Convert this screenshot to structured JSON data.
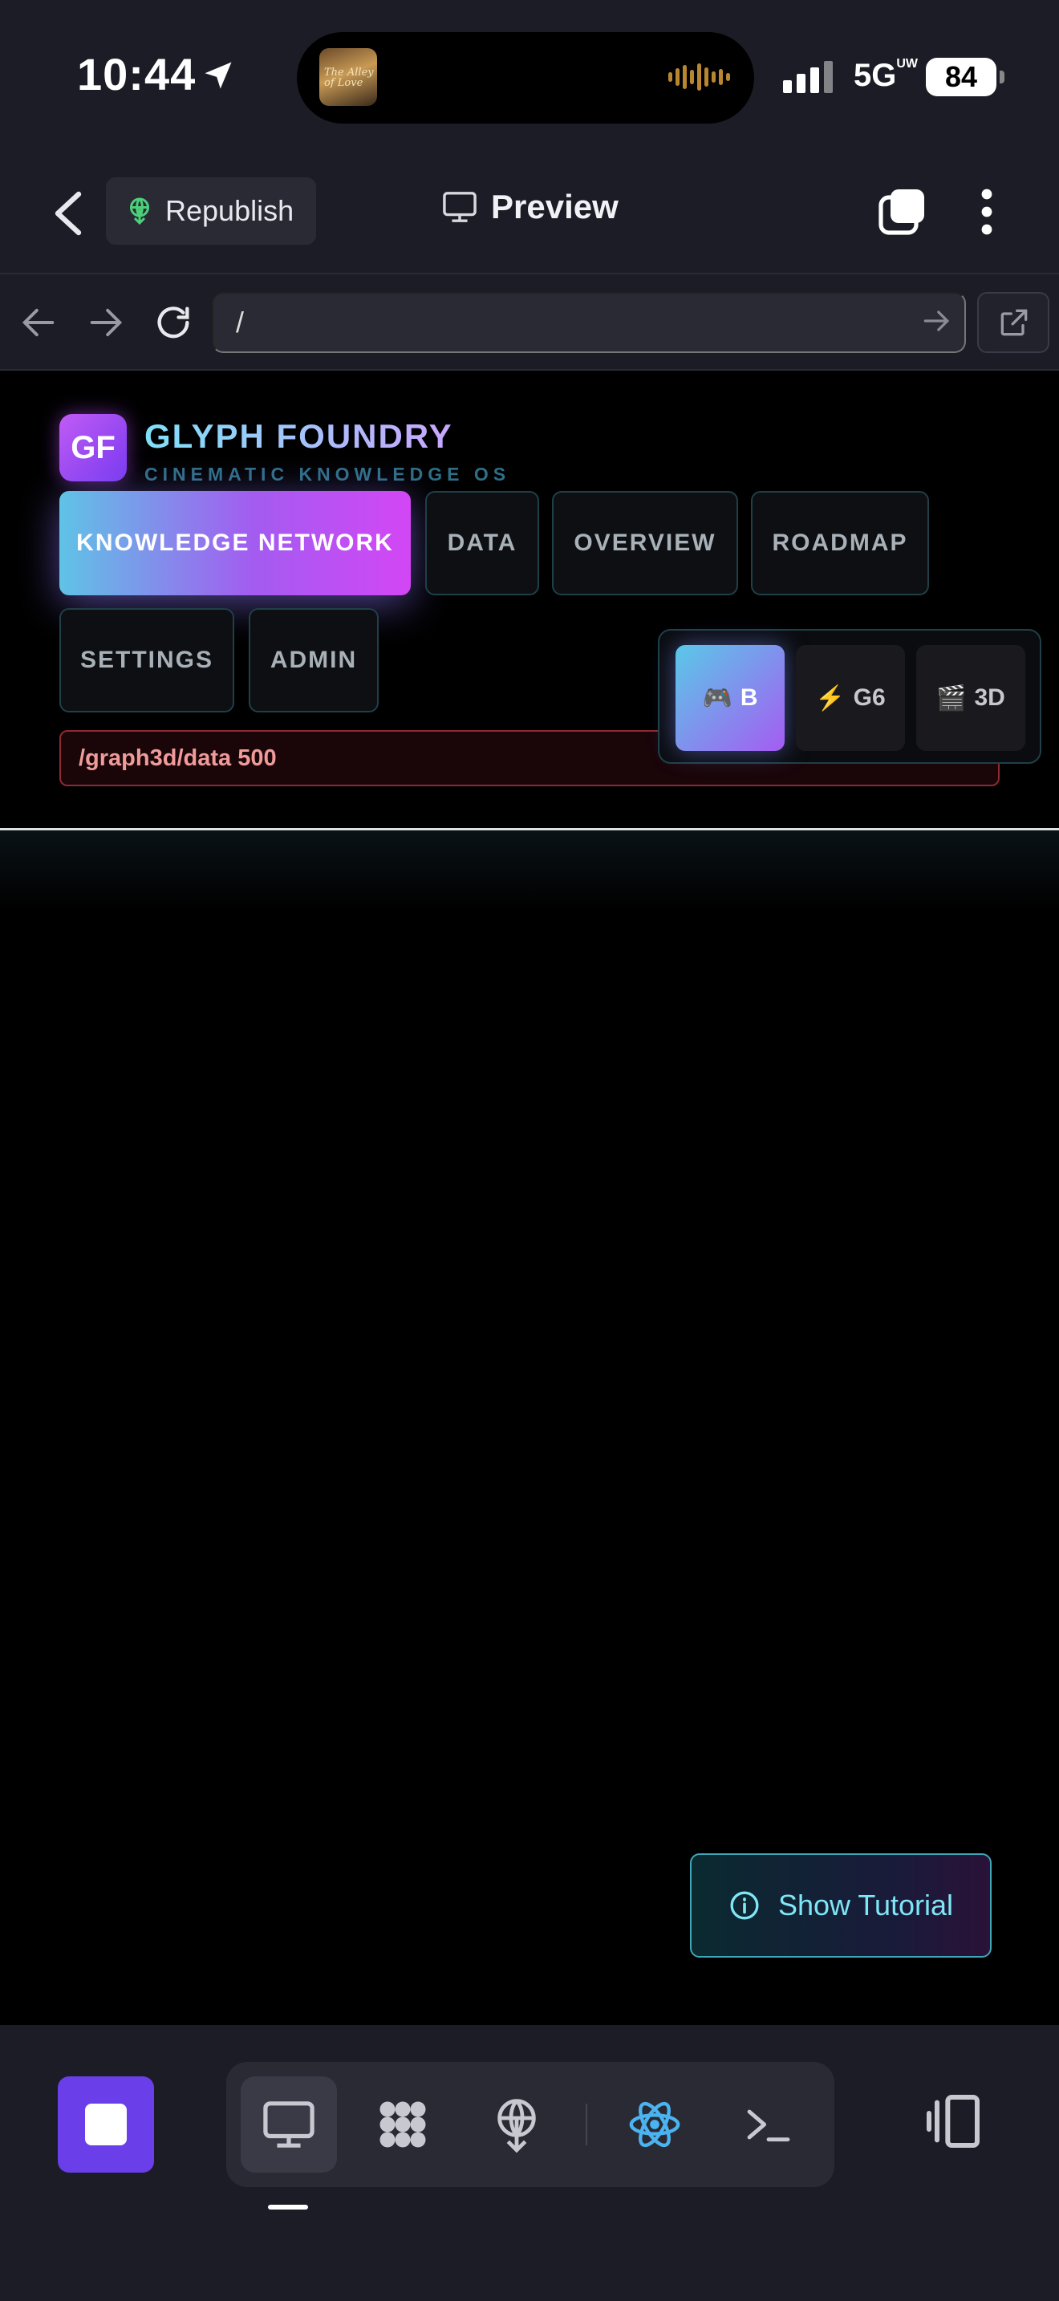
{
  "status_bar": {
    "time": "10:44",
    "album_art_text": "The Alley of Love",
    "network": "5G",
    "network_sup": "UW",
    "battery": "84"
  },
  "header": {
    "back_icon": "chevron-left-icon",
    "republish_label": "Republish",
    "republish_icon": "broadcast-icon",
    "title": "Preview",
    "title_icon": "monitor-icon",
    "tabs_icon": "tabs-icon",
    "more_icon": "more-vertical-icon"
  },
  "browser": {
    "url": "/",
    "icons": [
      "arrow-left-icon",
      "arrow-right-icon",
      "refresh-icon",
      "go-arrow-icon",
      "external-link-icon"
    ]
  },
  "app": {
    "logo": "GF",
    "title": "GLYPH FOUNDRY",
    "subtitle": "CINEMATIC KNOWLEDGE OS",
    "nav": [
      {
        "label": "KNOWLEDGE NETWORK",
        "active": true
      },
      {
        "label": "DATA",
        "active": false
      },
      {
        "label": "OVERVIEW",
        "active": false
      },
      {
        "label": "ROADMAP",
        "active": false
      },
      {
        "label": "SETTINGS",
        "active": false
      },
      {
        "label": "ADMIN",
        "active": false
      }
    ],
    "error": "/graph3d/data 500",
    "modes": [
      {
        "emoji": "🎮",
        "label": "B",
        "active": true
      },
      {
        "emoji": "⚡",
        "label": "G6",
        "active": false
      },
      {
        "emoji": "🎬",
        "label": "3D",
        "active": false
      }
    ],
    "tutorial_label": "Show Tutorial"
  },
  "toolbar": {
    "stop_icon": "stop-icon",
    "tools": [
      "desktop-icon",
      "grid-pattern-icon",
      "deploy-icon",
      "react-icon",
      "terminal-icon"
    ],
    "panel_icon": "panel-toggle-icon"
  },
  "colors": {
    "accent": "#6a3ee8",
    "chrome_bg": "#1c1c26",
    "error": "#8e2a32",
    "cyan": "#7fe6f5"
  }
}
